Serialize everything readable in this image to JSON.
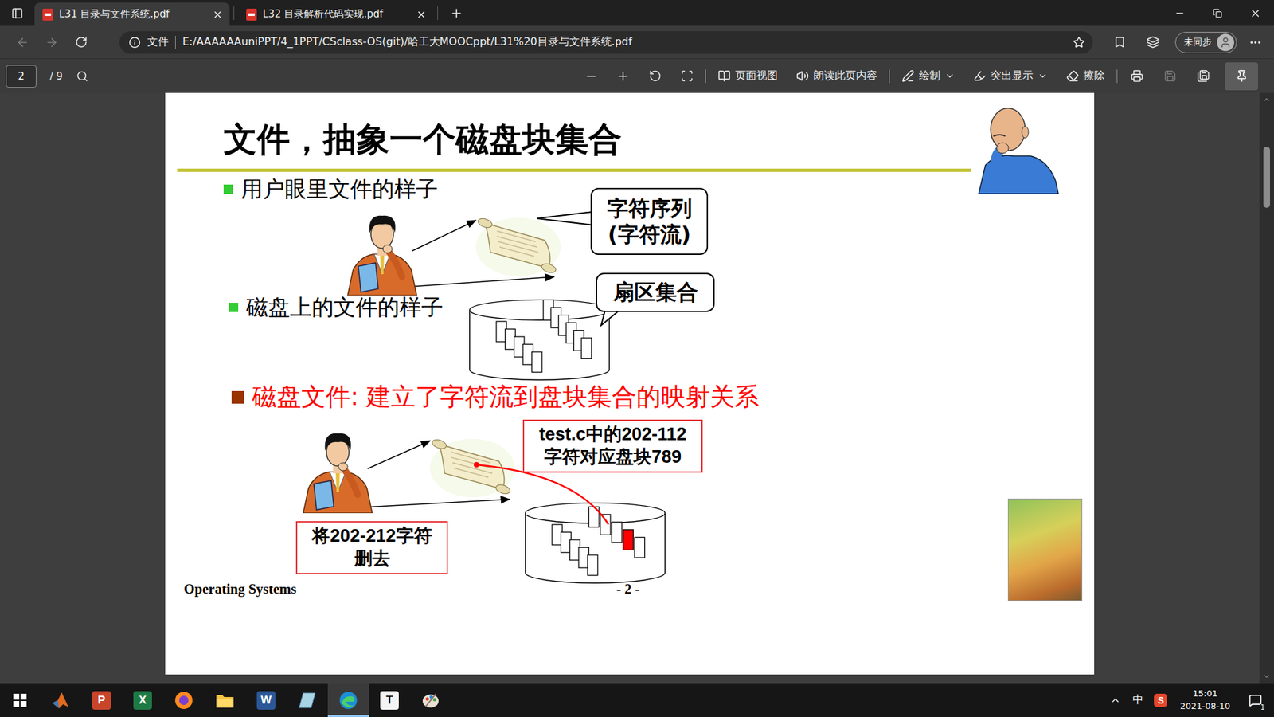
{
  "browser": {
    "tabs": [
      {
        "label": "L31 目录与文件系统.pdf",
        "selected": true
      },
      {
        "label": "L32 目录解析代码实现.pdf",
        "selected": false
      }
    ],
    "navigation": {
      "back_enabled": false,
      "forward_enabled": false
    },
    "address_bar": {
      "security_label": "文件",
      "url": "E:/AAAAAAuniPPT/4_1PPT/CSclass-OS(git)/哈工大MOOCppt/L31%20目录与文件系统.pdf"
    },
    "profile": {
      "label": "未同步"
    }
  },
  "pdf_toolbar": {
    "page": "2",
    "total": "/ 9",
    "tools": [
      {
        "label": "页面视图",
        "kind": "view",
        "dropdown": false
      },
      {
        "label": "朗读此页内容",
        "kind": "read",
        "dropdown": false
      },
      {
        "label": "绘制",
        "kind": "draw",
        "dropdown": true
      },
      {
        "label": "突出显示",
        "kind": "highlight",
        "dropdown": true
      },
      {
        "label": "擦除",
        "kind": "erase",
        "dropdown": false
      }
    ],
    "save_enabled": false,
    "pinned": true
  },
  "slide": {
    "title": "文件，抽象一个磁盘块集合",
    "sections": [
      {
        "text": "用户眼里文件的样子",
        "color": "#33cc33",
        "emphasis": false
      },
      {
        "text": "磁盘上的文件的样子",
        "color": "#33cc33",
        "emphasis": false
      },
      {
        "text": "磁盘文件: 建立了字符流到盘块集合的映射关系",
        "color": "#993300",
        "emphasis": true
      }
    ],
    "bubbles": [
      {
        "lines": [
          "字符序列",
          "(字符流)"
        ]
      },
      {
        "lines": [
          "扇区集合"
        ]
      }
    ],
    "callouts": [
      {
        "lines": [
          "test.c中的202-112",
          "字符对应盘块789"
        ]
      },
      {
        "lines": [
          "将202-212字符",
          "删去"
        ]
      }
    ],
    "mapped_block_highlighted": true,
    "footer": "Operating Systems",
    "page_number": "- 2 -"
  },
  "scrollbar": {
    "level": 0.08
  },
  "taskbar": {
    "apps": [
      {
        "kind": "start",
        "glyph": "",
        "active": false
      },
      {
        "kind": "matlab",
        "glyph": "",
        "active": false
      },
      {
        "kind": "powerpoint",
        "glyph": "P",
        "active": false
      },
      {
        "kind": "excel",
        "glyph": "X",
        "active": false
      },
      {
        "kind": "firefox",
        "glyph": "",
        "active": false
      },
      {
        "kind": "explorer",
        "glyph": "",
        "active": false
      },
      {
        "kind": "word",
        "glyph": "W",
        "active": false
      },
      {
        "kind": "notebook",
        "glyph": "",
        "active": false
      },
      {
        "kind": "edge",
        "glyph": "",
        "active": true
      },
      {
        "kind": "typora",
        "glyph": "T",
        "active": false
      },
      {
        "kind": "paint",
        "glyph": "",
        "active": false
      }
    ],
    "tray": {
      "ime": "中",
      "sogou": "S",
      "time": "15:01",
      "date": "2021-08-10",
      "notifications": "1"
    }
  }
}
